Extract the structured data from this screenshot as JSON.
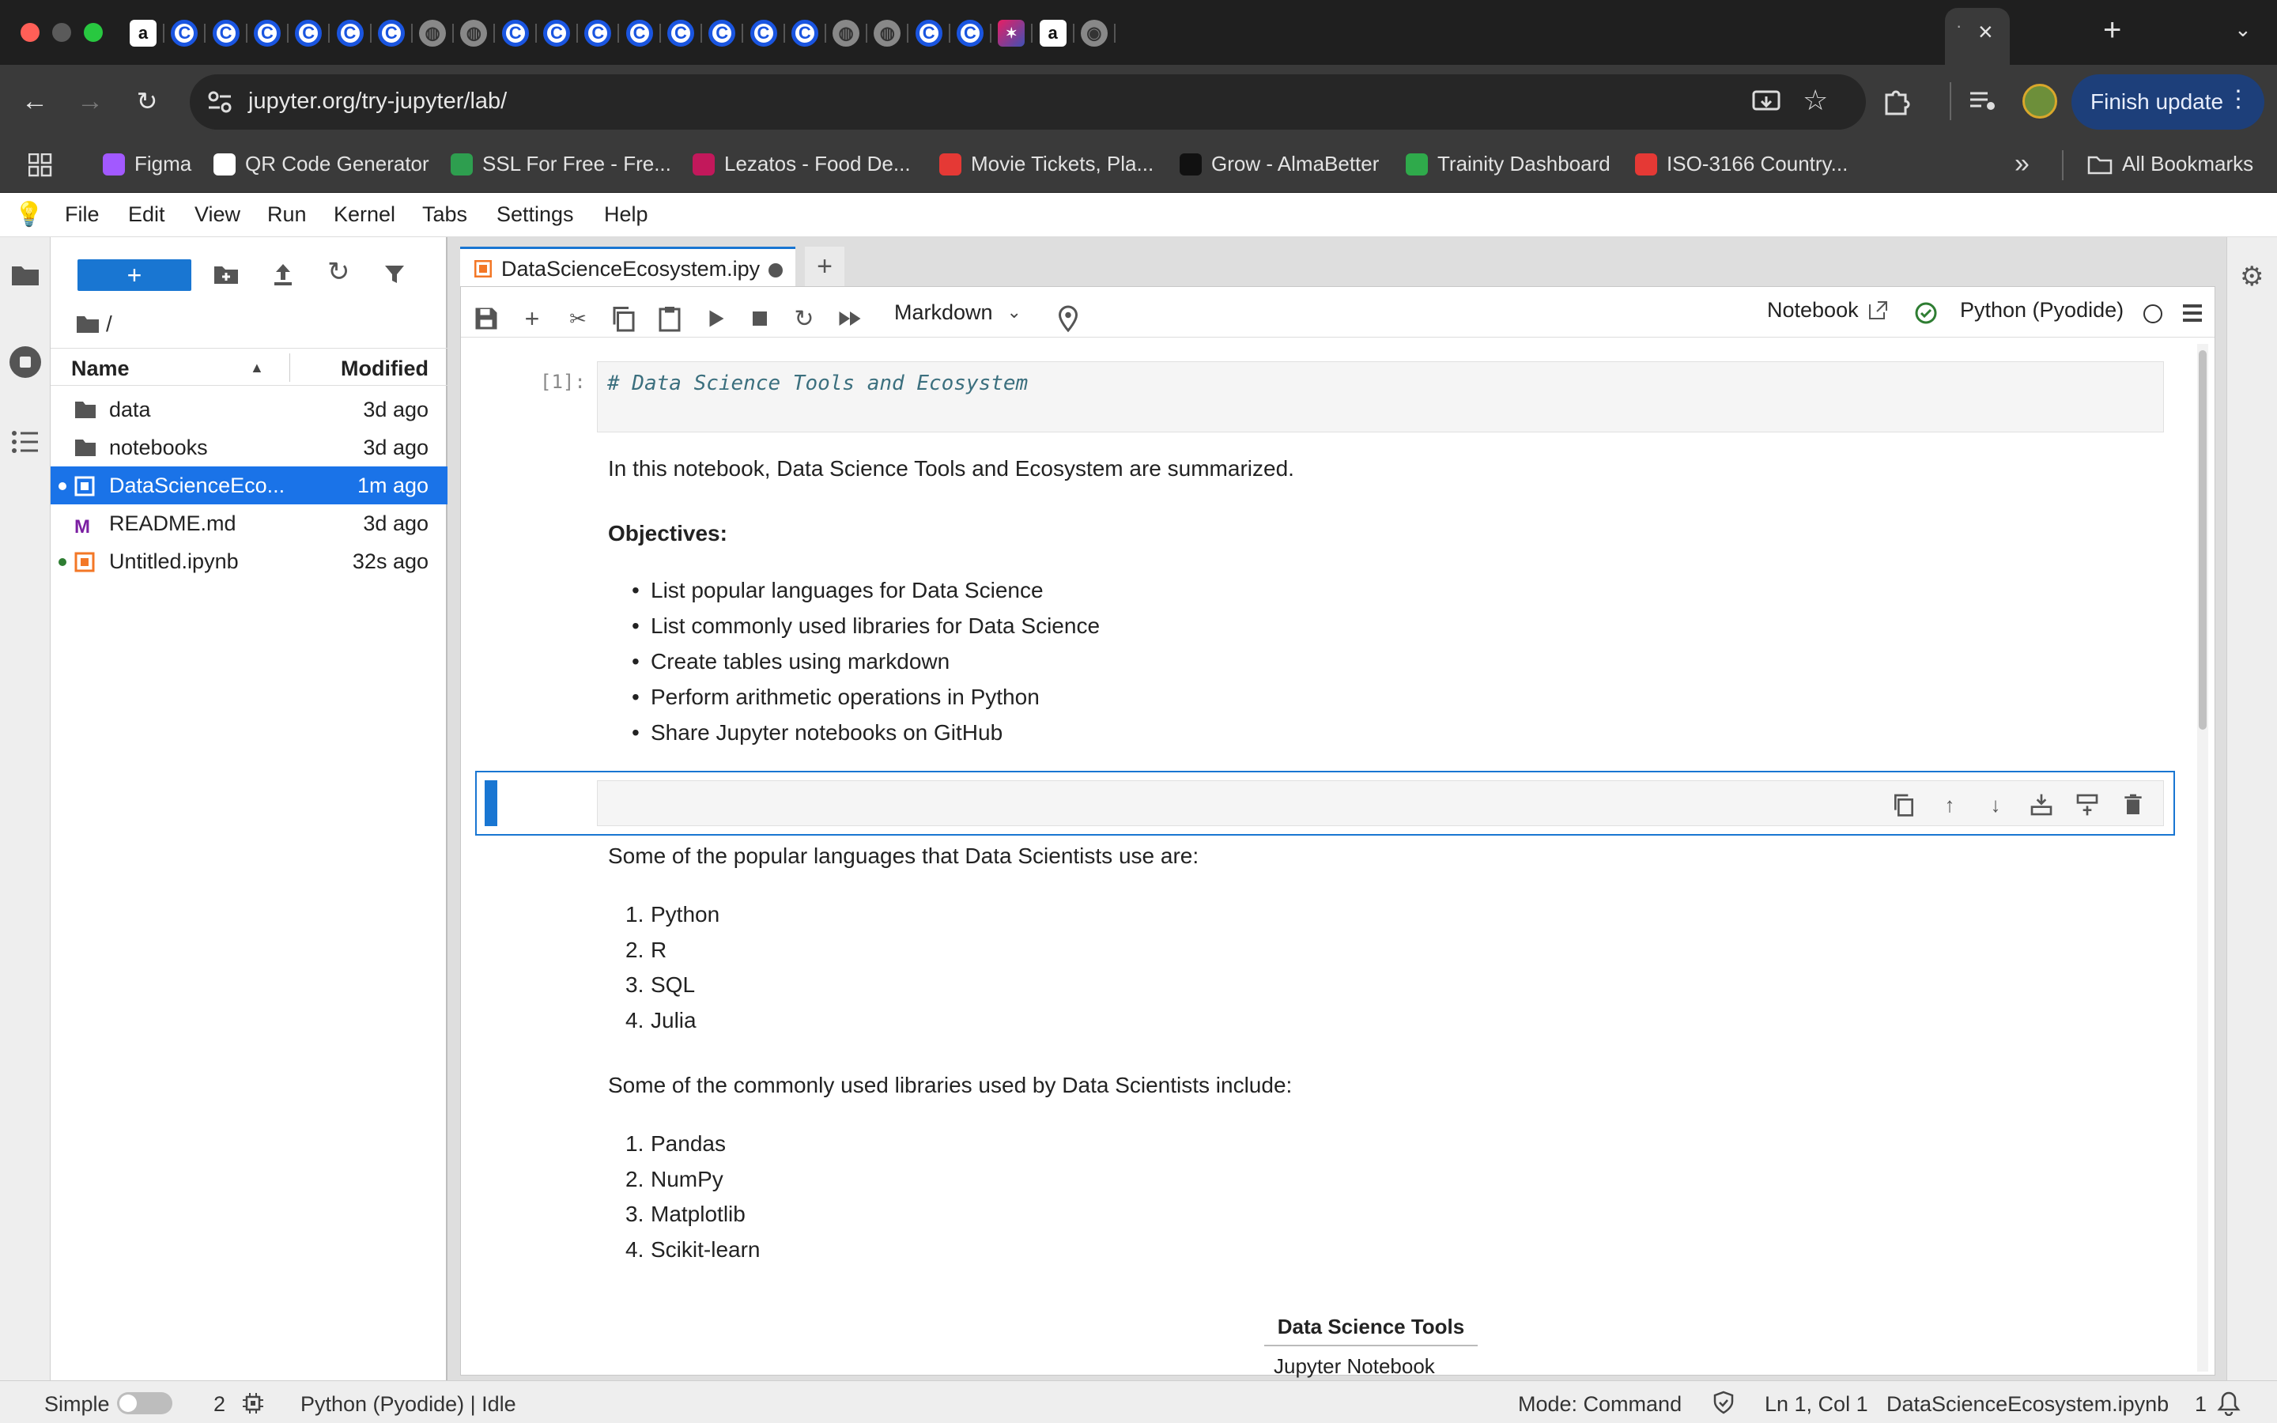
{
  "browser": {
    "url": "jupyter.org/try-jupyter/lab/",
    "finish_update": "Finish update",
    "tab_close": "×",
    "new_tab": "+",
    "tabs": [
      {
        "icon": "amazon-icon",
        "letter": "a",
        "kind": "a"
      },
      {
        "icon": "c-logo-icon",
        "letter": "C",
        "kind": "c"
      },
      {
        "icon": "c-logo-icon",
        "letter": "C",
        "kind": "c"
      },
      {
        "icon": "c-logo-icon",
        "letter": "C",
        "kind": "c"
      },
      {
        "icon": "c-logo-icon",
        "letter": "C",
        "kind": "c"
      },
      {
        "icon": "c-logo-icon",
        "letter": "C",
        "kind": "c"
      },
      {
        "icon": "c-logo-icon",
        "letter": "C",
        "kind": "c"
      },
      {
        "icon": "globe-icon",
        "letter": "◍",
        "kind": "g"
      },
      {
        "icon": "globe-icon",
        "letter": "◍",
        "kind": "g"
      },
      {
        "icon": "c-logo-icon",
        "letter": "C",
        "kind": "c"
      },
      {
        "icon": "c-logo-icon",
        "letter": "C",
        "kind": "c"
      },
      {
        "icon": "c-logo-icon",
        "letter": "C",
        "kind": "c"
      },
      {
        "icon": "c-logo-icon",
        "letter": "C",
        "kind": "c"
      },
      {
        "icon": "c-logo-icon",
        "letter": "C",
        "kind": "c"
      },
      {
        "icon": "c-logo-icon",
        "letter": "C",
        "kind": "c"
      },
      {
        "icon": "c-logo-icon",
        "letter": "C",
        "kind": "c"
      },
      {
        "icon": "c-logo-icon",
        "letter": "C",
        "kind": "c"
      },
      {
        "icon": "globe-icon",
        "letter": "◍",
        "kind": "g"
      },
      {
        "icon": "globe-icon",
        "letter": "◍",
        "kind": "g"
      },
      {
        "icon": "c-logo-icon",
        "letter": "C",
        "kind": "c"
      },
      {
        "icon": "c-logo-icon",
        "letter": "C",
        "kind": "c"
      },
      {
        "icon": "sparkle-app-icon",
        "letter": "✶",
        "kind": "p"
      },
      {
        "icon": "amazon-icon",
        "letter": "a",
        "kind": "a"
      },
      {
        "icon": "chrome-icon",
        "letter": "◉",
        "kind": "g"
      }
    ],
    "bookmarks": [
      {
        "label": "Figma",
        "color": "#a259ff"
      },
      {
        "label": "QR Code Generator",
        "color": "#ffffff"
      },
      {
        "label": "SSL For Free - Fre...",
        "color": "#2e9e4f"
      },
      {
        "label": "Lezatos - Food De...",
        "color": "#c2185b"
      },
      {
        "label": "Movie Tickets, Pla...",
        "color": "#e53935"
      },
      {
        "label": "Grow - AlmaBetter",
        "color": "#111111"
      },
      {
        "label": "Trainity Dashboard",
        "color": "#2faa4b"
      },
      {
        "label": "ISO-3166 Country...",
        "color": "#e53935"
      }
    ],
    "bookmark_more": "»",
    "all_bookmarks": "All Bookmarks"
  },
  "menu": [
    "File",
    "Edit",
    "View",
    "Run",
    "Kernel",
    "Tabs",
    "Settings",
    "Help"
  ],
  "filebrowser": {
    "new_label": "+",
    "path": "/",
    "col_name": "Name",
    "col_modified": "Modified",
    "sort_arrow": "▲",
    "items": [
      {
        "name": "data",
        "modified": "3d ago",
        "type": "folder",
        "running": false,
        "selected": false
      },
      {
        "name": "notebooks",
        "modified": "3d ago",
        "type": "folder",
        "running": false,
        "selected": false
      },
      {
        "name": "DataScienceEco...",
        "modified": "1m ago",
        "type": "notebook",
        "running": true,
        "selected": true
      },
      {
        "name": "README.md",
        "modified": "3d ago",
        "type": "markdown",
        "running": false,
        "selected": false
      },
      {
        "name": "Untitled.ipynb",
        "modified": "32s ago",
        "type": "notebook",
        "running": true,
        "selected": false
      }
    ]
  },
  "notebook": {
    "tab_title": "DataScienceEcosystem.ipy",
    "cell_type": "Markdown",
    "notebook_link": "Notebook",
    "kernel_name": "Python (Pyodide)",
    "prompt": "[1]:",
    "code_line": "# Data Science Tools and Ecosystem",
    "intro": "In this notebook, Data Science Tools and Ecosystem are summarized.",
    "objectives_heading": "Objectives:",
    "objectives": [
      "List popular languages for Data Science",
      "List commonly used libraries for Data Science",
      "Create tables using markdown",
      "Perform arithmetic operations in Python",
      "Share Jupyter notebooks on GitHub"
    ],
    "languages_intro": "Some of the popular languages that Data Scientists use are:",
    "languages": [
      "Python",
      "R",
      "SQL",
      "Julia"
    ],
    "libraries_intro": "Some of the commonly used libraries used by Data Scientists include:",
    "libraries": [
      "Pandas",
      "NumPy",
      "Matplotlib",
      "Scikit-learn"
    ],
    "table_header": "Data Science Tools",
    "table_first_row": "Jupyter Notebook"
  },
  "status": {
    "mode_label": "Simple",
    "terminals_count": "2",
    "kernel_status": "Python (Pyodide) | Idle",
    "mode": "Mode: Command",
    "cursor": "Ln 1, Col 1",
    "filename": "DataScienceEcosystem.ipynb",
    "notifications": "1"
  },
  "colors": {
    "accent": "#1976d2",
    "selected_row": "#1a73e8",
    "finish_update_bg": "#1d3f7a"
  }
}
